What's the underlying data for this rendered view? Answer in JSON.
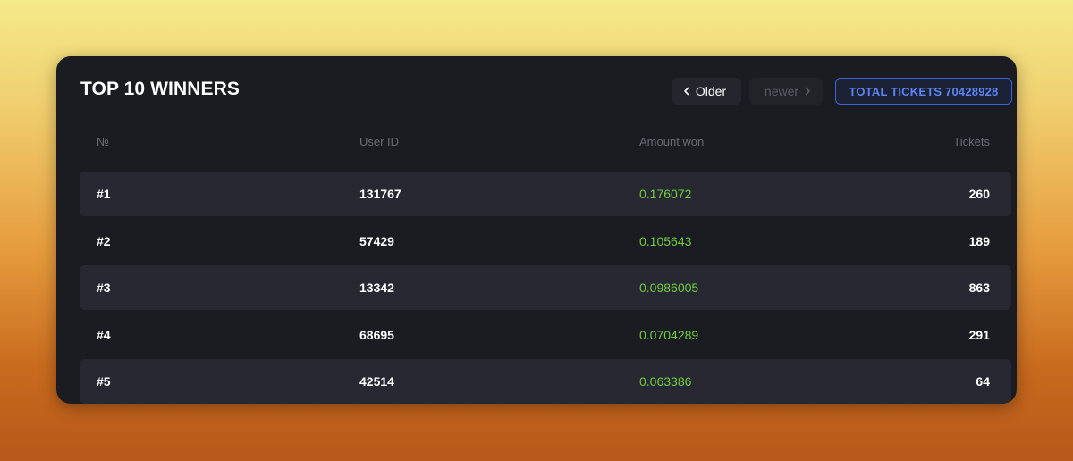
{
  "title": "TOP 10 WINNERS",
  "nav": {
    "older_label": "Older",
    "newer_label": "newer"
  },
  "total_tickets_label": "TOTAL TICKETS 70428928",
  "table": {
    "headers": {
      "number": "№",
      "user_id": "User ID",
      "amount_won": "Amount won",
      "tickets": "Tickets"
    },
    "rows": [
      {
        "rank": "#1",
        "user_id": "131767",
        "amount": "0.176072",
        "tickets": "260"
      },
      {
        "rank": "#2",
        "user_id": "57429",
        "amount": "0.105643",
        "tickets": "189"
      },
      {
        "rank": "#3",
        "user_id": "13342",
        "amount": "0.0986005",
        "tickets": "863"
      },
      {
        "rank": "#4",
        "user_id": "68695",
        "amount": "0.0704289",
        "tickets": "291"
      },
      {
        "rank": "#5",
        "user_id": "42514",
        "amount": "0.063386",
        "tickets": "64"
      }
    ]
  },
  "colors": {
    "accent_blue": "#3b63d6",
    "amount_green": "#6fce3a",
    "card_bg": "#1b1c21"
  }
}
